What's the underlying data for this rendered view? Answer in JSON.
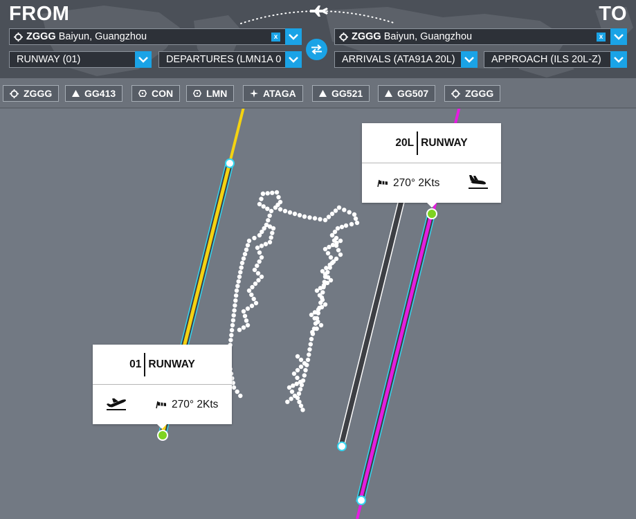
{
  "header": {
    "from_label": "FROM",
    "to_label": "TO",
    "from_airport": {
      "code": "ZGGG",
      "name": "Baiyun, Guangzhou"
    },
    "to_airport": {
      "code": "ZGGG",
      "name": "Baiyun, Guangzhou"
    },
    "clear_label": "x",
    "departure_runway": "RUNWAY (01)",
    "departure_procedure": "DEPARTURES (LMN1A 0",
    "arrival_procedure": "ARRIVALS (ATA91A 20L)",
    "approach_procedure": "APPROACH (ILS 20L-Z)"
  },
  "waypoints": [
    {
      "label": "ZGGG",
      "icon": "airport-icon"
    },
    {
      "label": "GG413",
      "icon": "triangle-icon"
    },
    {
      "label": "CON",
      "icon": "vor-icon"
    },
    {
      "label": "LMN",
      "icon": "vor-icon"
    },
    {
      "label": "ATAGA",
      "icon": "star-icon"
    },
    {
      "label": "GG521",
      "icon": "triangle-icon"
    },
    {
      "label": "GG507",
      "icon": "triangle-icon"
    },
    {
      "label": "ZGGG",
      "icon": "airport-icon"
    }
  ],
  "runway_cards": {
    "departure": {
      "number": "01",
      "label": "RUNWAY",
      "wind": "270° 2Kts",
      "icon": "takeoff-icon"
    },
    "arrival": {
      "number": "20L",
      "label": "RUNWAY",
      "wind": "270° 2Kts",
      "icon": "landing-icon"
    }
  },
  "colors": {
    "accent": "#1aa3e6",
    "departure_route": "#f5d311",
    "arrival_route": "#e51ce0",
    "route_outline": "#34d5f0",
    "waypoint_green": "#7ed321"
  }
}
